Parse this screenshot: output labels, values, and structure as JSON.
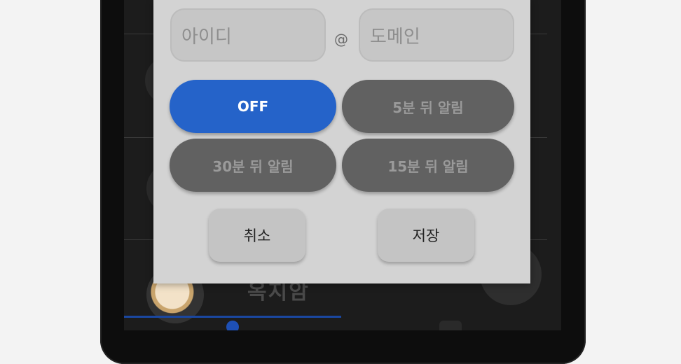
{
  "dialog": {
    "email": {
      "id_placeholder": "아이디",
      "at_symbol": "@",
      "domain_placeholder": "도메인"
    },
    "alarm_options": [
      {
        "label": "OFF",
        "selected": true
      },
      {
        "label": "5분 뒤 알림",
        "selected": false
      },
      {
        "label": "30분 뒤 알림",
        "selected": false
      },
      {
        "label": "15분 뒤 알림",
        "selected": false
      }
    ],
    "actions": {
      "cancel_label": "취소",
      "save_label": "저장"
    }
  },
  "background": {
    "contact_name": "옥지암"
  },
  "colors": {
    "accent": "#2563c9",
    "dialog_bg": "#d3d3d3",
    "pill_inactive": "#616161"
  }
}
